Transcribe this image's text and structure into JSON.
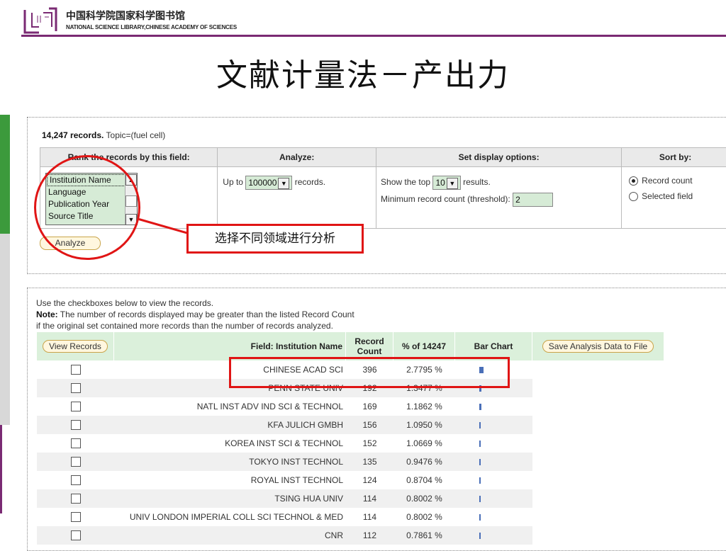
{
  "header": {
    "brand_cn": "中国科学院国家科学图书馆",
    "brand_en": "NATIONAL SCIENCE LIBRARY,CHINESE ACADEMY OF SCIENCES",
    "title": "文献计量法－产出力"
  },
  "query": {
    "records": "14,247 records.",
    "topic": "Topic=(fuel cell)"
  },
  "options": {
    "headers": [
      "Rank the records by this field:",
      "Analyze:",
      "Set display options:",
      "Sort by:"
    ],
    "rank_fields": [
      "Institution Name",
      "Language",
      "Publication Year",
      "Source Title"
    ],
    "analyze_prefix": "Up to",
    "analyze_value": "100000",
    "analyze_suffix": "records.",
    "show_top_prefix": "Show the top",
    "show_top_value": "10",
    "show_top_suffix": "results.",
    "min_count_label": "Minimum record count (threshold):",
    "min_count_value": "2",
    "sort_options": [
      "Record count",
      "Selected field"
    ],
    "sort_selected": "Record count",
    "analyze_button": "Analyze"
  },
  "annotation": {
    "note": "选择不同领域进行分析"
  },
  "results": {
    "instr1": "Use the checkboxes below to view the records.",
    "note_label": "Note:",
    "note_text": " The number of records displayed may be greater than the listed Record Count",
    "instr3": "if the original set contained more records than the number of records analyzed.",
    "view_button": "View Records",
    "col_field": "Field: Institution Name",
    "col_count": "Record Count",
    "col_pct": "% of 14247",
    "col_chart": "Bar Chart",
    "save_button": "Save Analysis Data to File",
    "bar_color": "#4a6fb8",
    "rows": [
      {
        "field": "CHINESE ACAD SCI",
        "count": "396",
        "pct": "2.7795 %"
      },
      {
        "field": "PENN STATE UNIV",
        "count": "192",
        "pct": "1.3477 %"
      },
      {
        "field": "NATL INST ADV IND SCI & TECHNOL",
        "count": "169",
        "pct": "1.1862 %"
      },
      {
        "field": "KFA JULICH GMBH",
        "count": "156",
        "pct": "1.0950 %"
      },
      {
        "field": "KOREA INST SCI & TECHNOL",
        "count": "152",
        "pct": "1.0669 %"
      },
      {
        "field": "TOKYO INST TECHNOL",
        "count": "135",
        "pct": "0.9476 %"
      },
      {
        "field": "ROYAL INST TECHNOL",
        "count": "124",
        "pct": "0.8704 %"
      },
      {
        "field": "TSING HUA UNIV",
        "count": "114",
        "pct": "0.8002 %"
      },
      {
        "field": "UNIV LONDON IMPERIAL COLL SCI TECHNOL & MED",
        "count": "114",
        "pct": "0.8002 %"
      },
      {
        "field": "CNR",
        "count": "112",
        "pct": "0.7861 %"
      }
    ]
  }
}
